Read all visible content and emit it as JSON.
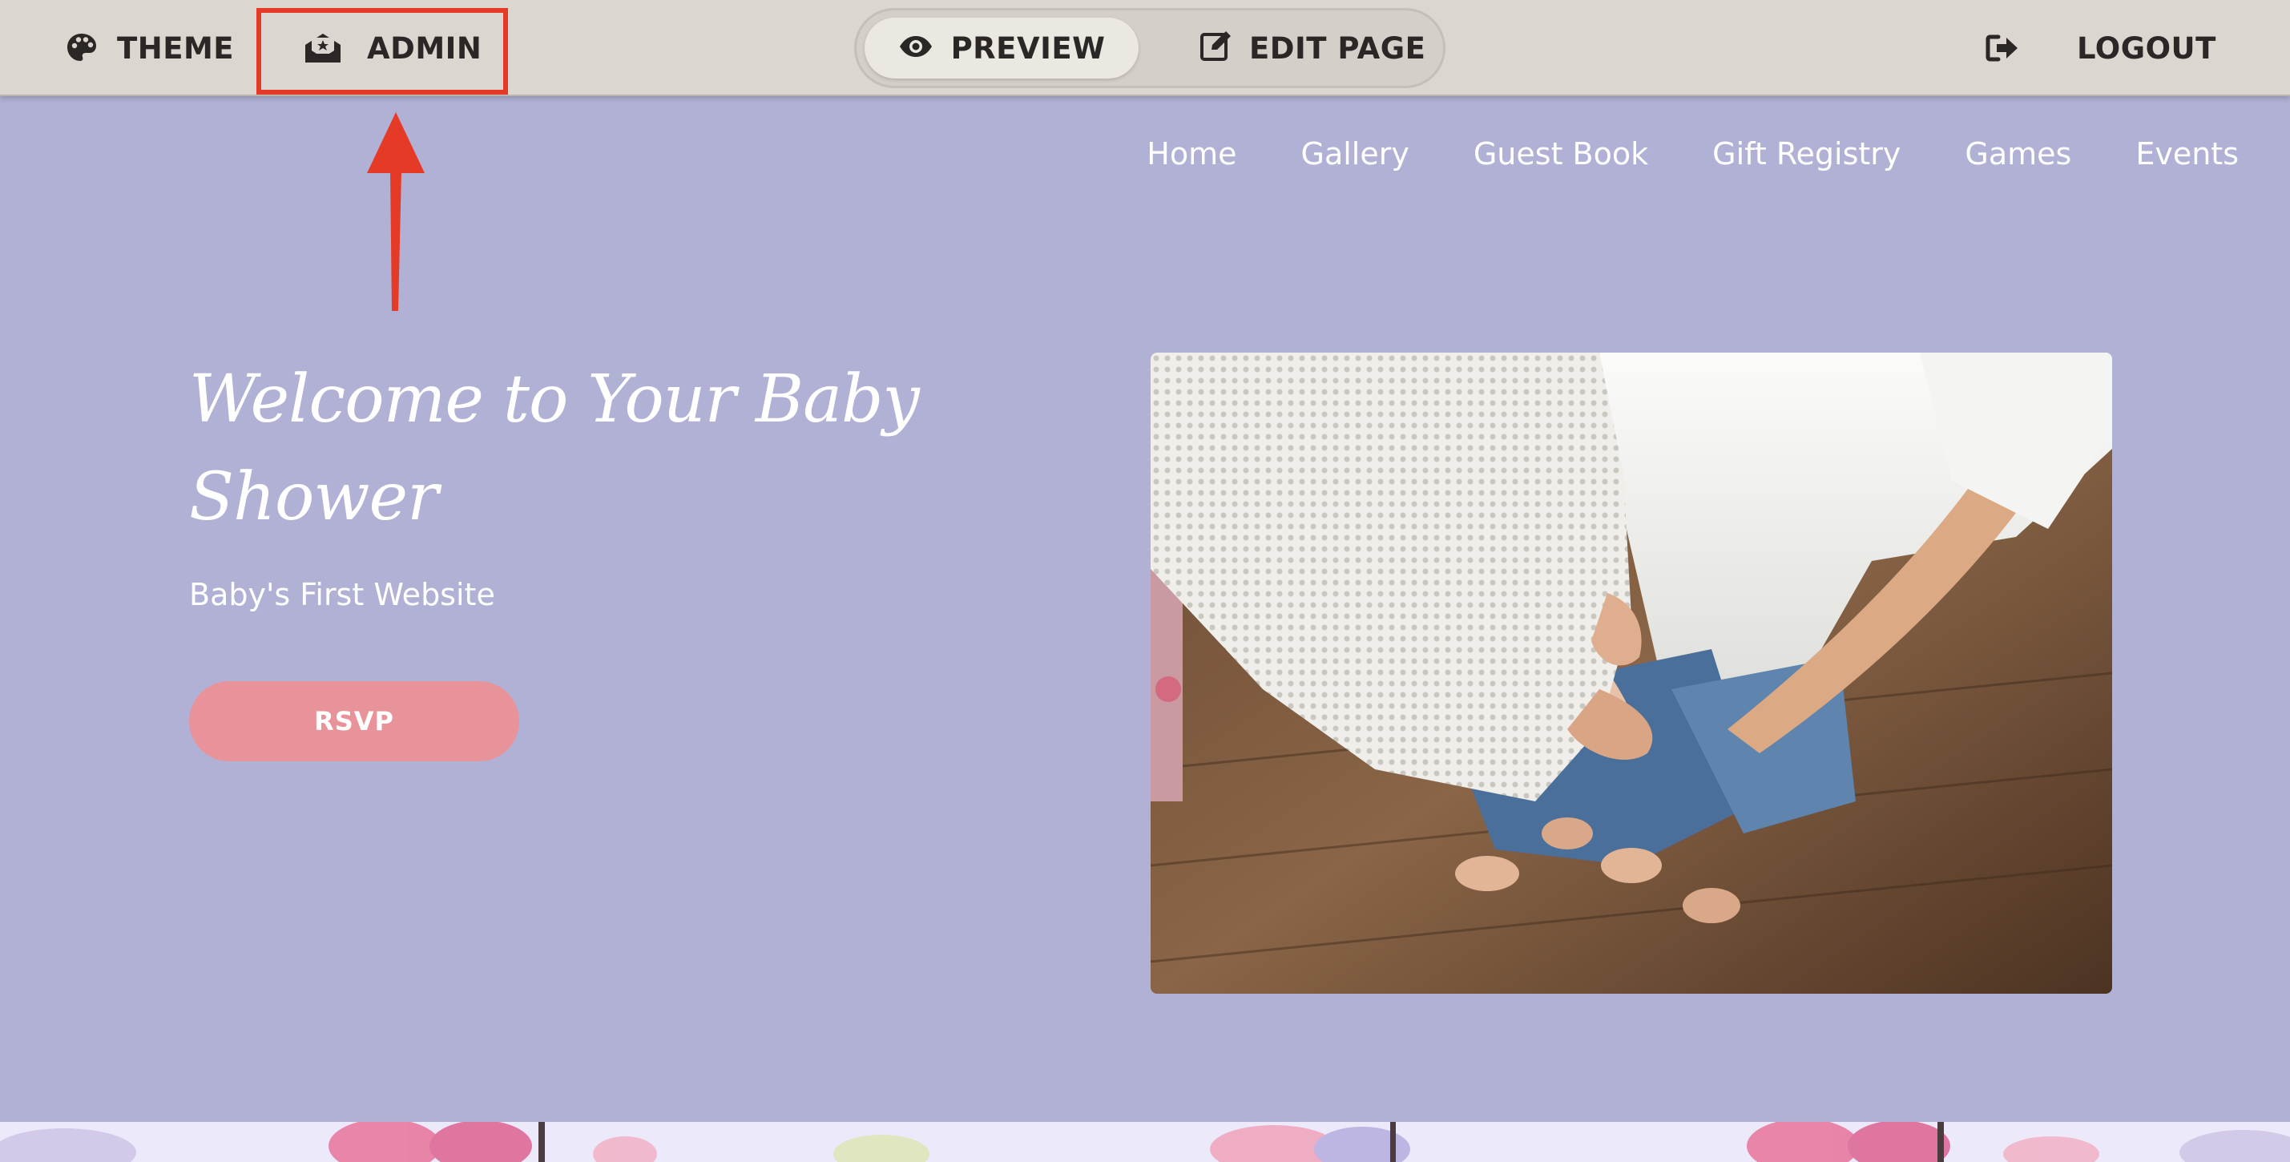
{
  "toolbar": {
    "theme_label": "THEME",
    "admin_label": "ADMIN",
    "preview_label": "PREVIEW",
    "edit_label": "EDIT PAGE",
    "logout_label": "LOGOUT",
    "icons": {
      "theme": "palette-icon",
      "admin": "envelope-icon",
      "preview": "eye-icon",
      "edit": "edit-icon",
      "logout": "sign-out-icon"
    },
    "active_mode": "PREVIEW"
  },
  "nav": {
    "items": [
      {
        "label": "Home"
      },
      {
        "label": "Gallery"
      },
      {
        "label": "Guest Book"
      },
      {
        "label": "Gift Registry"
      },
      {
        "label": "Games"
      },
      {
        "label": "Events"
      }
    ]
  },
  "hero": {
    "title": "Welcome to Your Baby Shower",
    "subtitle": "Baby's First Website",
    "rsvp_label": "RSVP",
    "photo_alt": "Expecting couple photo"
  },
  "colors": {
    "toolbar_bg": "#dbd6cf",
    "page_bg": "#b1b1d5",
    "accent_button": "#e8939a",
    "highlight": "#e53a26",
    "band_bg": "#ece9fb"
  }
}
